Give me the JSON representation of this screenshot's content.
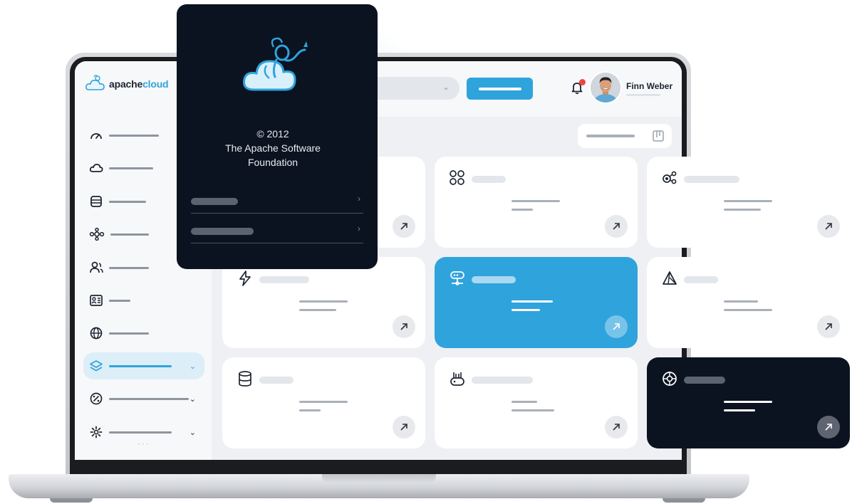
{
  "header": {
    "brand_prefix": "apache",
    "brand_suffix": "cloud",
    "user_name": "Finn Weber"
  },
  "popup": {
    "copyright_line1": "© 2012",
    "copyright_line2": "The Apache Software",
    "copyright_line3": "Foundation"
  },
  "sidebar": {
    "items": [
      {
        "icon": "gauge-icon"
      },
      {
        "icon": "cloud-icon"
      },
      {
        "icon": "database-rows-icon"
      },
      {
        "icon": "network-icon"
      },
      {
        "icon": "users-icon"
      },
      {
        "icon": "id-card-icon"
      },
      {
        "icon": "globe-icon"
      },
      {
        "icon": "layers-icon",
        "active": true
      },
      {
        "icon": "percent-badge-icon"
      },
      {
        "icon": "gear-icon"
      }
    ],
    "footer": "···"
  },
  "cards": [
    {
      "icon": "apps-grid-icon"
    },
    {
      "icon": "nodes-icon"
    },
    {
      "icon": "lightning-icon"
    },
    {
      "icon": "kubernetes-icon",
      "variant": "blue"
    },
    {
      "icon": "triangle-icon"
    },
    {
      "icon": "database-icon"
    },
    {
      "icon": "router-icon"
    },
    {
      "icon": "helm-icon",
      "variant": "dark"
    }
  ],
  "colors": {
    "accent": "#2fa3dc",
    "dark": "#0b1320",
    "notification": "#ef4444"
  }
}
